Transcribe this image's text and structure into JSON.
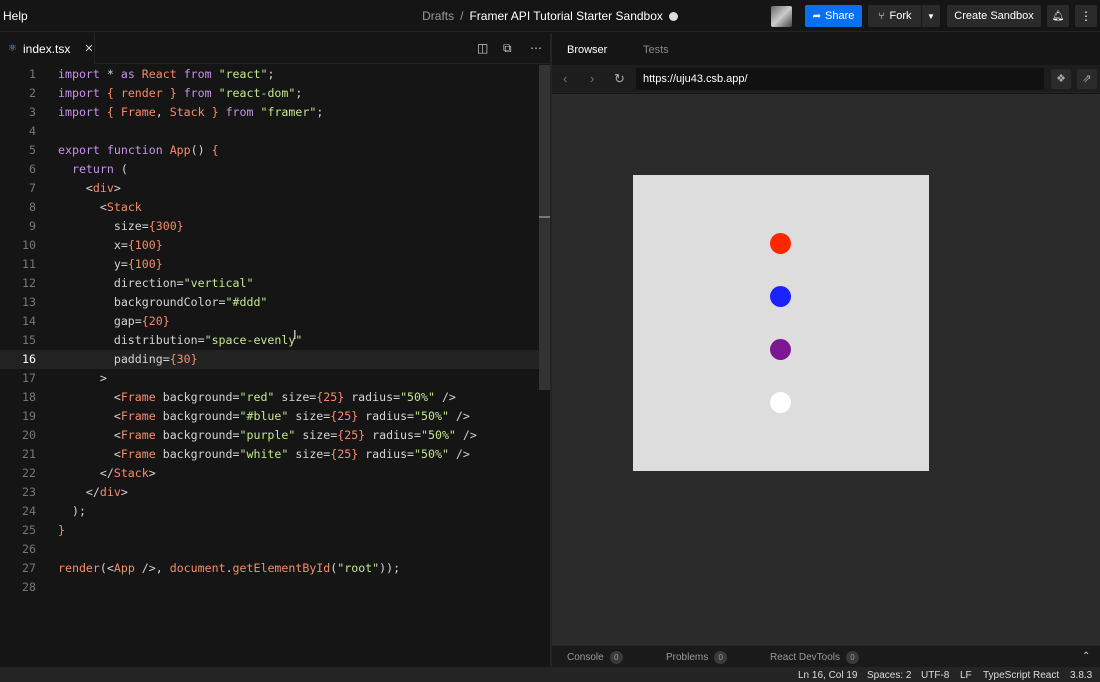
{
  "topbar": {
    "help": "Help",
    "breadcrumb_drafts": "Drafts",
    "breadcrumb_sep": "/",
    "sandbox_title": "Framer API Tutorial Starter Sandbox",
    "share": "Share",
    "fork": "Fork",
    "create_sandbox": "Create Sandbox"
  },
  "editor": {
    "tab_name": "index.tsx",
    "lines": [
      {
        "n": "1",
        "t": "import * as React from \"react\";"
      },
      {
        "n": "2",
        "t": "import { render } from \"react-dom\";"
      },
      {
        "n": "3",
        "t": "import { Frame, Stack } from \"framer\";"
      },
      {
        "n": "4",
        "t": ""
      },
      {
        "n": "5",
        "t": "export function App() {"
      },
      {
        "n": "6",
        "t": "  return ("
      },
      {
        "n": "7",
        "t": "    <div>"
      },
      {
        "n": "8",
        "t": "      <Stack"
      },
      {
        "n": "9",
        "t": "        size={300}"
      },
      {
        "n": "10",
        "t": "        x={100}"
      },
      {
        "n": "11",
        "t": "        y={100}"
      },
      {
        "n": "12",
        "t": "        direction=\"vertical\""
      },
      {
        "n": "13",
        "t": "        backgroundColor=\"#ddd\""
      },
      {
        "n": "14",
        "t": "        gap={20}"
      },
      {
        "n": "15",
        "t": "        distribution=\"space-evenly\""
      },
      {
        "n": "16",
        "t": "        padding={30}"
      },
      {
        "n": "17",
        "t": "      >"
      },
      {
        "n": "18",
        "t": "        <Frame background=\"red\" size={25} radius=\"50%\" />"
      },
      {
        "n": "19",
        "t": "        <Frame background=\"#blue\" size={25} radius=\"50%\" />"
      },
      {
        "n": "20",
        "t": "        <Frame background=\"purple\" size={25} radius=\"50%\" />"
      },
      {
        "n": "21",
        "t": "        <Frame background=\"white\" size={25} radius=\"50%\" />"
      },
      {
        "n": "22",
        "t": "      </Stack>"
      },
      {
        "n": "23",
        "t": "    </div>"
      },
      {
        "n": "24",
        "t": "  );"
      },
      {
        "n": "25",
        "t": "}"
      },
      {
        "n": "26",
        "t": ""
      },
      {
        "n": "27",
        "t": "render(<App />, document.getElementById(\"root\"));"
      },
      {
        "n": "28",
        "t": ""
      }
    ],
    "current_line": "16"
  },
  "browser": {
    "tab_browser": "Browser",
    "tab_tests": "Tests",
    "url": "https://uju43.csb.app/",
    "dot_colors": [
      "#ff2600",
      "#1a23ff",
      "#7d1791",
      "#ffffff"
    ],
    "stack_bg": "#dddddd"
  },
  "bottom_tabs": [
    {
      "label": "Console",
      "count": "0"
    },
    {
      "label": "Problems",
      "count": "0"
    },
    {
      "label": "React DevTools",
      "count": "0"
    }
  ],
  "status": {
    "position": "Ln 16, Col 19",
    "spaces": "Spaces: 2",
    "encoding": "UTF-8",
    "eol": "LF",
    "language": "TypeScript React",
    "version": "3.8.3"
  },
  "colors": {
    "accent": "#0971f1",
    "keyword": "#c792ea",
    "string": "#c3e88d",
    "identifier": "#f78c6c"
  }
}
